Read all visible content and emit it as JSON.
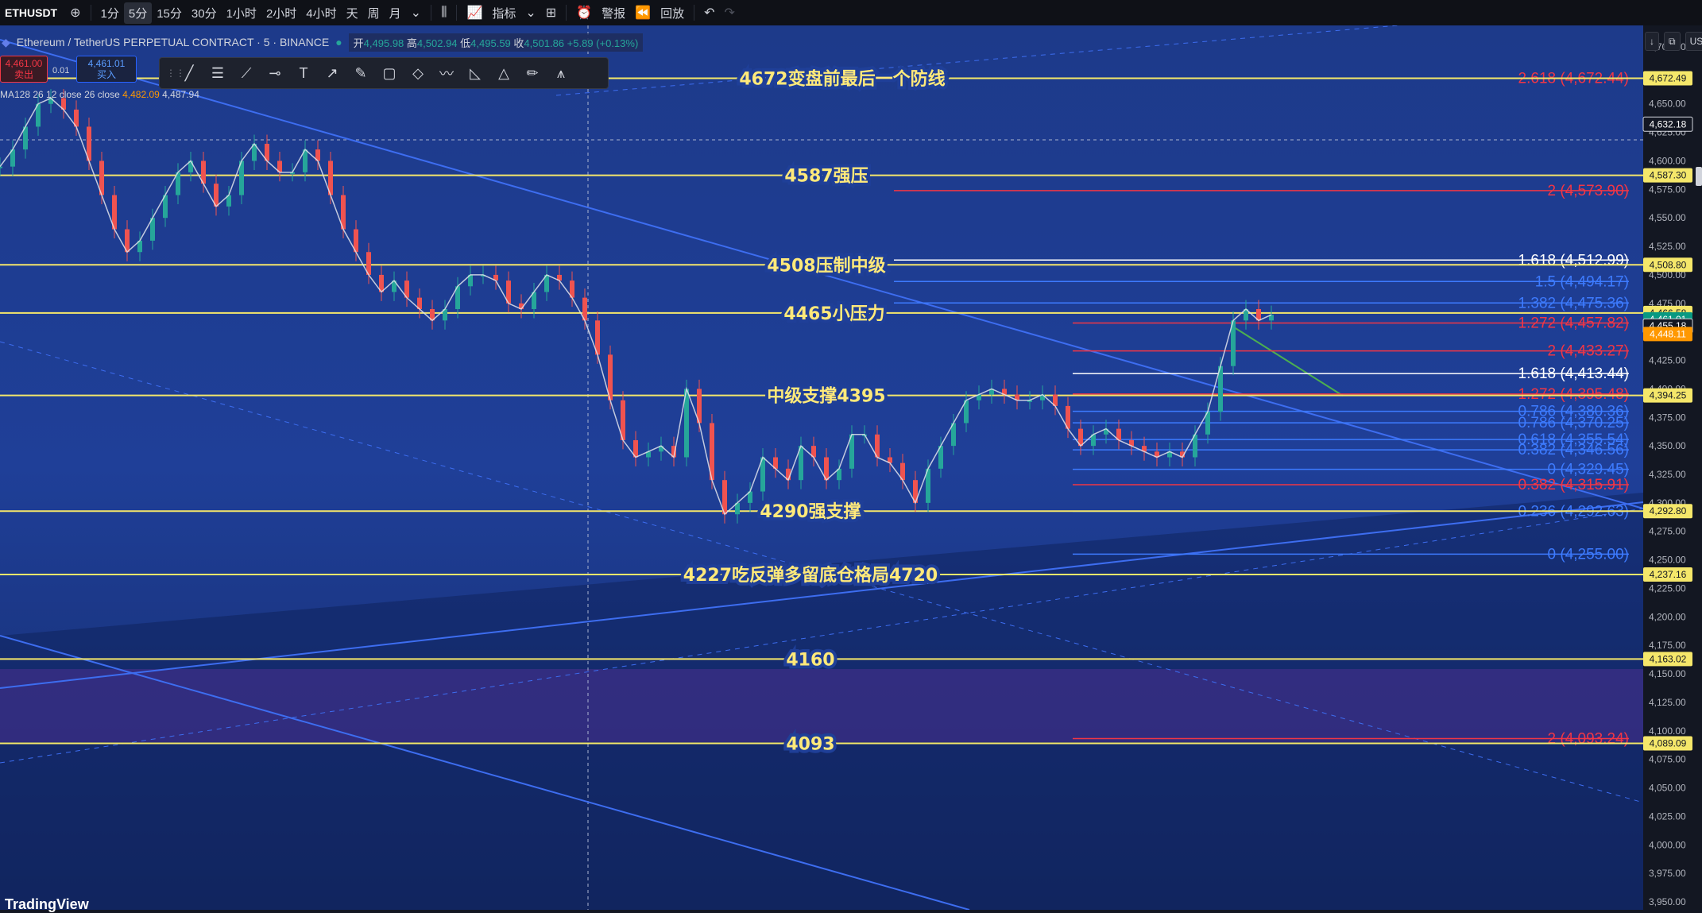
{
  "toolbar": {
    "symbol": "ETHUSDT",
    "timeframes": [
      {
        "label": "1分",
        "active": false
      },
      {
        "label": "5分",
        "active": true
      },
      {
        "label": "15分",
        "active": false
      },
      {
        "label": "30分",
        "active": false
      },
      {
        "label": "1小时",
        "active": false
      },
      {
        "label": "2小时",
        "active": false
      },
      {
        "label": "4小时",
        "active": false
      },
      {
        "label": "天",
        "active": false
      },
      {
        "label": "周",
        "active": false
      },
      {
        "label": "月",
        "active": false
      }
    ],
    "indicators_label": "指标",
    "alert_label": "警报",
    "replay_label": "回放",
    "icons": [
      "add-symbol-icon",
      "chevron-down-icon",
      "candles-icon",
      "indicators-icon",
      "layout-icon",
      "alert-icon",
      "replay-icon",
      "undo-icon",
      "redo-icon"
    ]
  },
  "infobar": {
    "title": "Ethereum / TetherUS PERPETUAL CONTRACT · 5 · BINANCE",
    "open_label": "开",
    "open": "4,495.98",
    "high_label": "高",
    "high": "4,502.94",
    "low_label": "低",
    "low": "4,495.59",
    "close_label": "收",
    "close": "4,501.86",
    "change": "+5.89 (+0.13%)"
  },
  "trade": {
    "sell_price": "4,461.00",
    "sell_label": "卖出",
    "spread": "0.01",
    "buy_price": "4,461.01",
    "buy_label": "买入"
  },
  "ma": {
    "label": "MA128 26 12 close 26 close",
    "v1": "4,482.09",
    "v2": "4,487.94"
  },
  "drawing_tools": [
    "cursor-line-icon",
    "horizontal-lines-icon",
    "brush-icon",
    "ray-icon",
    "text-icon",
    "arrow-icon",
    "pen-icon",
    "rectangle-icon",
    "shape-icon",
    "wave-icon",
    "measure-icon",
    "triangle-icon",
    "pencil-icon",
    "pattern-icon"
  ],
  "right_panel": {
    "currency": "USDT"
  },
  "logo": "TradingView",
  "chart_data": {
    "type": "line",
    "y_range": [
      3950,
      4700
    ],
    "y_ticks": [
      "4,700.00",
      "4,675.00",
      "4,650.00",
      "4,625.00",
      "4,600.00",
      "4,575.00",
      "4,550.00",
      "4,525.00",
      "4,500.00",
      "4,475.00",
      "4,450.00",
      "4,425.00",
      "4,400.00",
      "4,375.00",
      "4,350.00",
      "4,325.00",
      "4,300.00",
      "4,275.00",
      "4,250.00",
      "4,225.00",
      "4,200.00",
      "4,175.00",
      "4,150.00",
      "4,125.00",
      "4,100.00",
      "4,075.00",
      "4,050.00",
      "4,025.00",
      "4,000.00",
      "3,975.00",
      "3,950.00"
    ],
    "horizontal_levels": [
      {
        "price": 4672.49,
        "label": "4672变盘前最后一个防线",
        "badge": "4,672.49"
      },
      {
        "price": 4587.3,
        "label": "4587强压",
        "badge": "4,587.30"
      },
      {
        "price": 4508.8,
        "label": "4508压制中级",
        "badge": "4,508.80"
      },
      {
        "price": 4466.58,
        "label": "4465小压力",
        "badge": "4,466.58"
      },
      {
        "price": 4394.25,
        "label": "中级支撑4395",
        "badge": "4,394.25"
      },
      {
        "price": 4292.8,
        "label": "4290强支撑",
        "badge": "4,292.80"
      },
      {
        "price": 4237.16,
        "label": "4227吃反弹多留底仓格局4720",
        "badge": "4,237.16"
      },
      {
        "price": 4163.02,
        "label": "4160",
        "badge": "4,163.02"
      },
      {
        "price": 4089.09,
        "label": "4093",
        "badge": "4,089.09"
      }
    ],
    "other_badges": [
      {
        "price": 4632.18,
        "label": "4,632.18"
      },
      {
        "price": 4461.01,
        "label": "4,461.01",
        "sub": "02:26"
      },
      {
        "price": 4455.18,
        "label": "4,455.18"
      },
      {
        "price": 4448.11,
        "label": "4,448.11"
      }
    ],
    "fib_labels": [
      {
        "price": 4672.44,
        "text": "2.618 (4,672.44)"
      },
      {
        "price": 4573.9,
        "text": "2 (4,573.90)"
      },
      {
        "price": 4512.99,
        "text": "1.618 (4,512.99)"
      },
      {
        "price": 4494.17,
        "text": "1.5 (4,494.17)"
      },
      {
        "price": 4475.36,
        "text": "1.382 (4,475.36)"
      },
      {
        "price": 4457.82,
        "text": "1.272 (4,457.82)"
      },
      {
        "price": 4433.27,
        "text": "2 (4,433.27)"
      },
      {
        "price": 4413.44,
        "text": "1.618 (4,413.44)"
      },
      {
        "price": 4395.48,
        "text": "1.272 (4,395.48)"
      },
      {
        "price": 4380.36,
        "text": "0.786 (4,380.36)"
      },
      {
        "price": 4370.25,
        "text": "0.786 (4,370.25)"
      },
      {
        "price": 4355.54,
        "text": "0.618 (4,355.54)"
      },
      {
        "price": 4346.56,
        "text": "0.382 (4,346.56)"
      },
      {
        "price": 4329.45,
        "text": "0 (4,329.45)"
      },
      {
        "price": 4315.91,
        "text": "0.382 (4,315.91)"
      },
      {
        "price": 4292.63,
        "text": "0.236 (4,292.63)"
      },
      {
        "price": 4255.0,
        "text": "0 (4,255.00)"
      },
      {
        "price": 4093.24,
        "text": "2 (4,093.24)"
      }
    ],
    "price_path": [
      4595,
      4610,
      4630,
      4650,
      4655,
      4645,
      4630,
      4600,
      4570,
      4540,
      4520,
      4530,
      4550,
      4570,
      4590,
      4600,
      4580,
      4560,
      4570,
      4600,
      4615,
      4600,
      4590,
      4590,
      4610,
      4600,
      4570,
      4540,
      4520,
      4500,
      4485,
      4495,
      4480,
      4470,
      4460,
      4470,
      4490,
      4500,
      4500,
      4495,
      4475,
      4470,
      4485,
      4500,
      4495,
      4480,
      4460,
      4430,
      4390,
      4355,
      4340,
      4345,
      4350,
      4340,
      4400,
      4370,
      4320,
      4290,
      4300,
      4310,
      4340,
      4330,
      4320,
      4350,
      4340,
      4320,
      4330,
      4360,
      4360,
      4340,
      4335,
      4320,
      4300,
      4330,
      4350,
      4370,
      4390,
      4395,
      4400,
      4395,
      4390,
      4390,
      4395,
      4385,
      4365,
      4350,
      4360,
      4365,
      4355,
      4350,
      4345,
      4340,
      4345,
      4340,
      4360,
      4380,
      4420,
      4460,
      4470,
      4460,
      4465
    ]
  }
}
